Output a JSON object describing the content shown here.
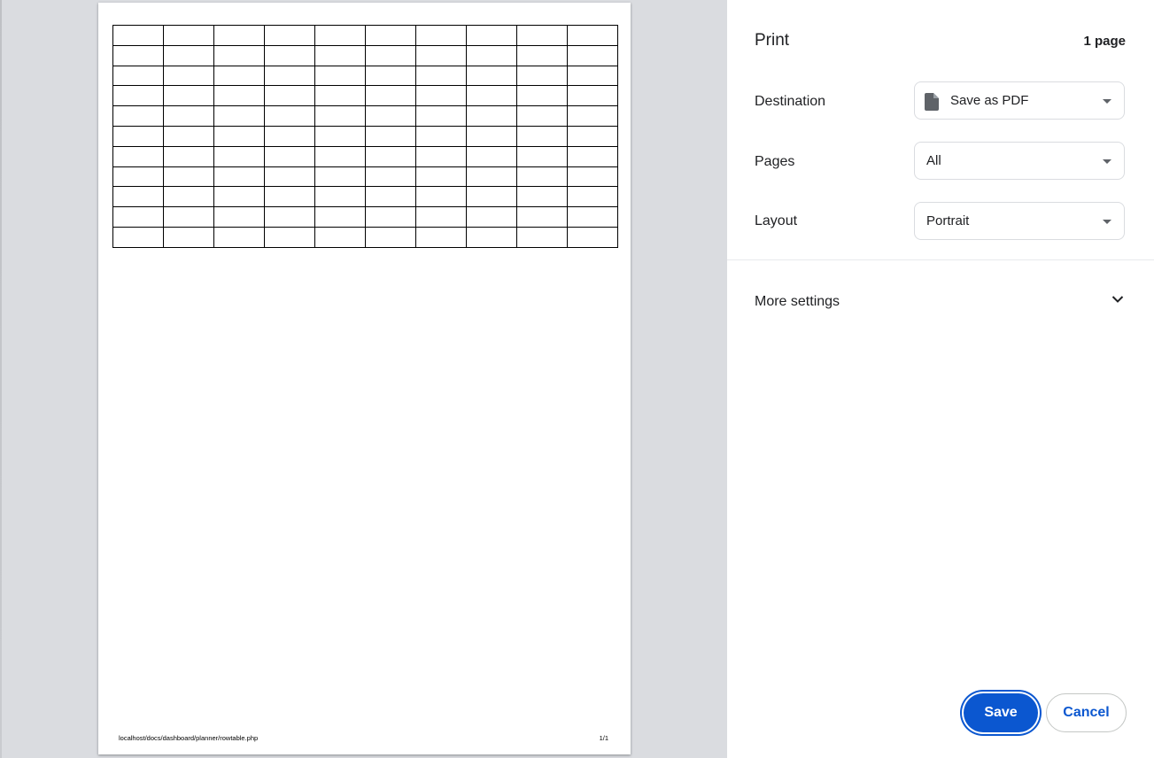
{
  "preview": {
    "table": {
      "rows": 11,
      "cols": 10
    },
    "footer_url": "localhost/docs/dashboard/planner/rowtable.php",
    "footer_page": "1/1"
  },
  "sidebar": {
    "title": "Print",
    "page_count": "1 page",
    "destination": {
      "label": "Destination",
      "value": "Save as PDF",
      "icon": "pdf-file-icon"
    },
    "pages": {
      "label": "Pages",
      "value": "All"
    },
    "layout": {
      "label": "Layout",
      "value": "Portrait"
    },
    "more_settings": {
      "label": "More settings",
      "icon": "chevron-down-icon"
    },
    "buttons": {
      "save": "Save",
      "cancel": "Cancel"
    }
  },
  "colors": {
    "accent": "#0b57d0",
    "preview_background": "#dadce0",
    "text": "#202124"
  }
}
